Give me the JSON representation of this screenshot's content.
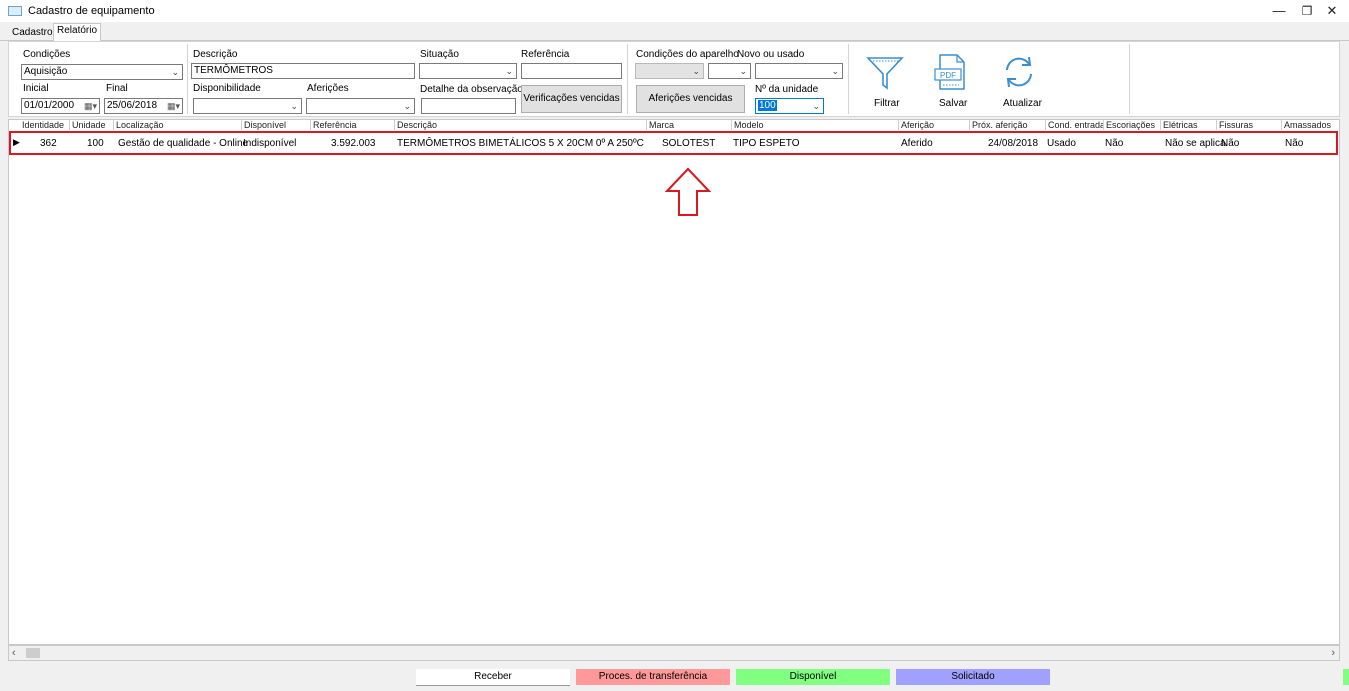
{
  "window": {
    "title": "Cadastro de equipamento",
    "minimize": "—",
    "restore": "❐",
    "close": "✕"
  },
  "tabs": [
    {
      "label": "Cadastro"
    },
    {
      "label": "Relatório"
    }
  ],
  "filters": {
    "condicoes_label": "Condições",
    "condicoes_value": "Aquisição",
    "inicial_label": "Inicial",
    "inicial_value": "01/01/2000",
    "final_label": "Final",
    "final_value": "25/06/2018",
    "descricao_label": "Descrição",
    "descricao_value": "TERMÔMETROS",
    "disponibilidade_label": "Disponibilidade",
    "disponibilidade_value": "",
    "afericoes_label": "Aferições",
    "afericoes_value": "",
    "situacao_label": "Situação",
    "situacao_value": "",
    "referencia_label": "Referência",
    "referencia_value": "",
    "detalhe_label": "Detalhe da observação",
    "detalhe_value": "",
    "verificacoes_button": "Verificações vencidas",
    "cond_aparelho_label": "Condições do aparelho",
    "afericoes_vencidas_button": "Aferições vencidas",
    "novo_usado_label": "Novo ou usado",
    "novo_usado_value": "",
    "unidade_label": "Nº da unidade",
    "unidade_value": "100"
  },
  "toolbar": {
    "filtrar": "Filtrar",
    "salvar": "Salvar",
    "atualizar": "Atualizar",
    "pdf_text": "PDF"
  },
  "grid": {
    "columns": [
      "Identidade",
      "Unidade",
      "Localização",
      "Disponível",
      "Referência",
      "Descrição",
      "Marca",
      "Modelo",
      "Aferição",
      "Próx. aferição",
      "Cond. entrada",
      "Escoriações",
      "Elétricas",
      "Fissuras",
      "Amassados"
    ],
    "rows": [
      {
        "identidade": "362",
        "unidade": "100",
        "localizacao": "Gestão de qualidade - Online",
        "disponivel": "Indisponível",
        "referencia": "3.592.003",
        "descricao": "TERMÔMETROS BIMETÁLICOS 5 X 20CM 0º A 250ºC",
        "marca": "SOLOTEST",
        "modelo": "TIPO ESPETO",
        "afericao": "Aferido",
        "prox_afericao": "24/08/2018",
        "cond_entrada": "Usado",
        "escoriacoes": "Não",
        "eletricas": "Não se aplica",
        "fissuras": "Não",
        "amassados": "Não"
      }
    ]
  },
  "legend": [
    {
      "label": "Receber",
      "color": "#ffffff"
    },
    {
      "label": "Proces. de transferência",
      "color": "#ff9999"
    },
    {
      "label": "Disponível",
      "color": "#80ff80"
    },
    {
      "label": "Solicitado",
      "color": "#a0a0ff"
    }
  ],
  "colors": {
    "highlight": "#d9181f",
    "selection": "#0078d7"
  }
}
